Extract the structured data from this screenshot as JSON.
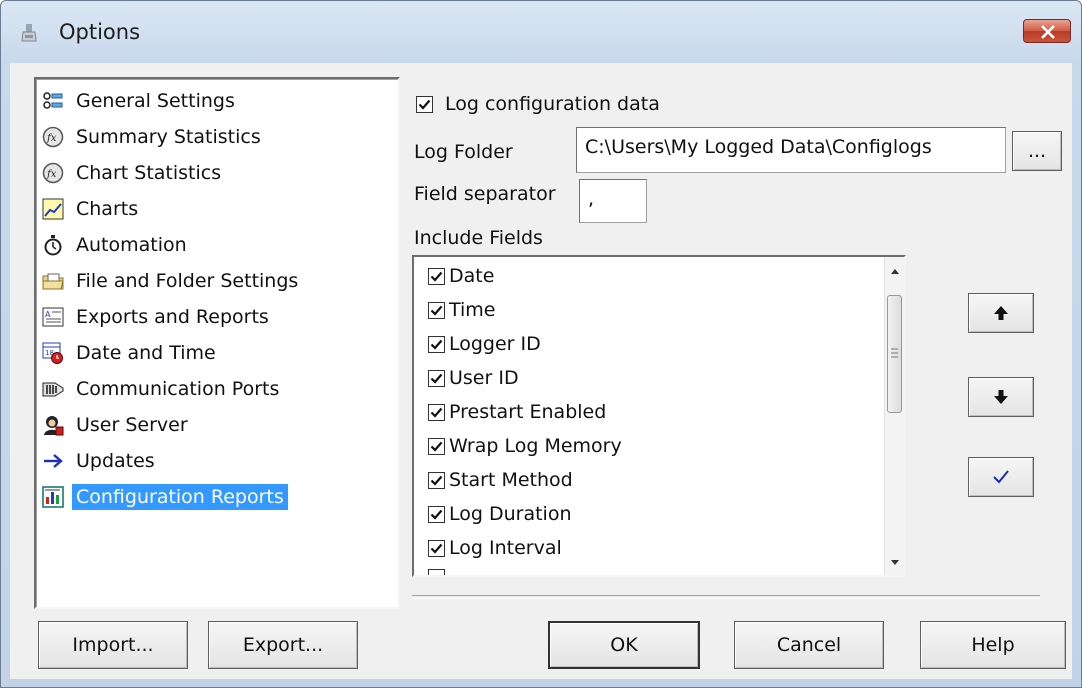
{
  "window": {
    "title": "Options"
  },
  "nav": {
    "items": [
      {
        "label": "General Settings",
        "icon": "general-settings-icon"
      },
      {
        "label": "Summary Statistics",
        "icon": "fx-icon"
      },
      {
        "label": "Chart Statistics",
        "icon": "fx-icon"
      },
      {
        "label": "Charts",
        "icon": "chart-icon"
      },
      {
        "label": "Automation",
        "icon": "stopwatch-icon"
      },
      {
        "label": "File and Folder Settings",
        "icon": "folder-icon"
      },
      {
        "label": "Exports and Reports",
        "icon": "report-icon"
      },
      {
        "label": "Date and Time",
        "icon": "calendar-clock-icon"
      },
      {
        "label": "Communication Ports",
        "icon": "port-icon"
      },
      {
        "label": "User Server",
        "icon": "user-server-icon"
      },
      {
        "label": "Updates",
        "icon": "arrow-right-icon"
      },
      {
        "label": "Configuration Reports",
        "icon": "config-report-icon",
        "selected": true
      }
    ]
  },
  "config": {
    "log_checkbox_label": "Log configuration data",
    "log_checkbox_checked": true,
    "log_folder_label": "Log Folder",
    "log_folder_value": "C:\\Users\\My Logged Data\\Configlogs",
    "browse_label": "...",
    "field_separator_label": "Field separator",
    "field_separator_value": ",",
    "include_fields_label": "Include Fields",
    "fields": [
      {
        "label": "Date",
        "checked": true
      },
      {
        "label": "Time",
        "checked": true
      },
      {
        "label": "Logger ID",
        "checked": true
      },
      {
        "label": "User ID",
        "checked": true
      },
      {
        "label": "Prestart Enabled",
        "checked": true
      },
      {
        "label": "Wrap Log Memory",
        "checked": true
      },
      {
        "label": "Start Method",
        "checked": true
      },
      {
        "label": "Log Duration",
        "checked": true
      },
      {
        "label": "Log Interval",
        "checked": true
      }
    ]
  },
  "footer": {
    "import_label": "Import...",
    "export_label": "Export...",
    "ok_label": "OK",
    "cancel_label": "Cancel",
    "help_label": "Help"
  }
}
